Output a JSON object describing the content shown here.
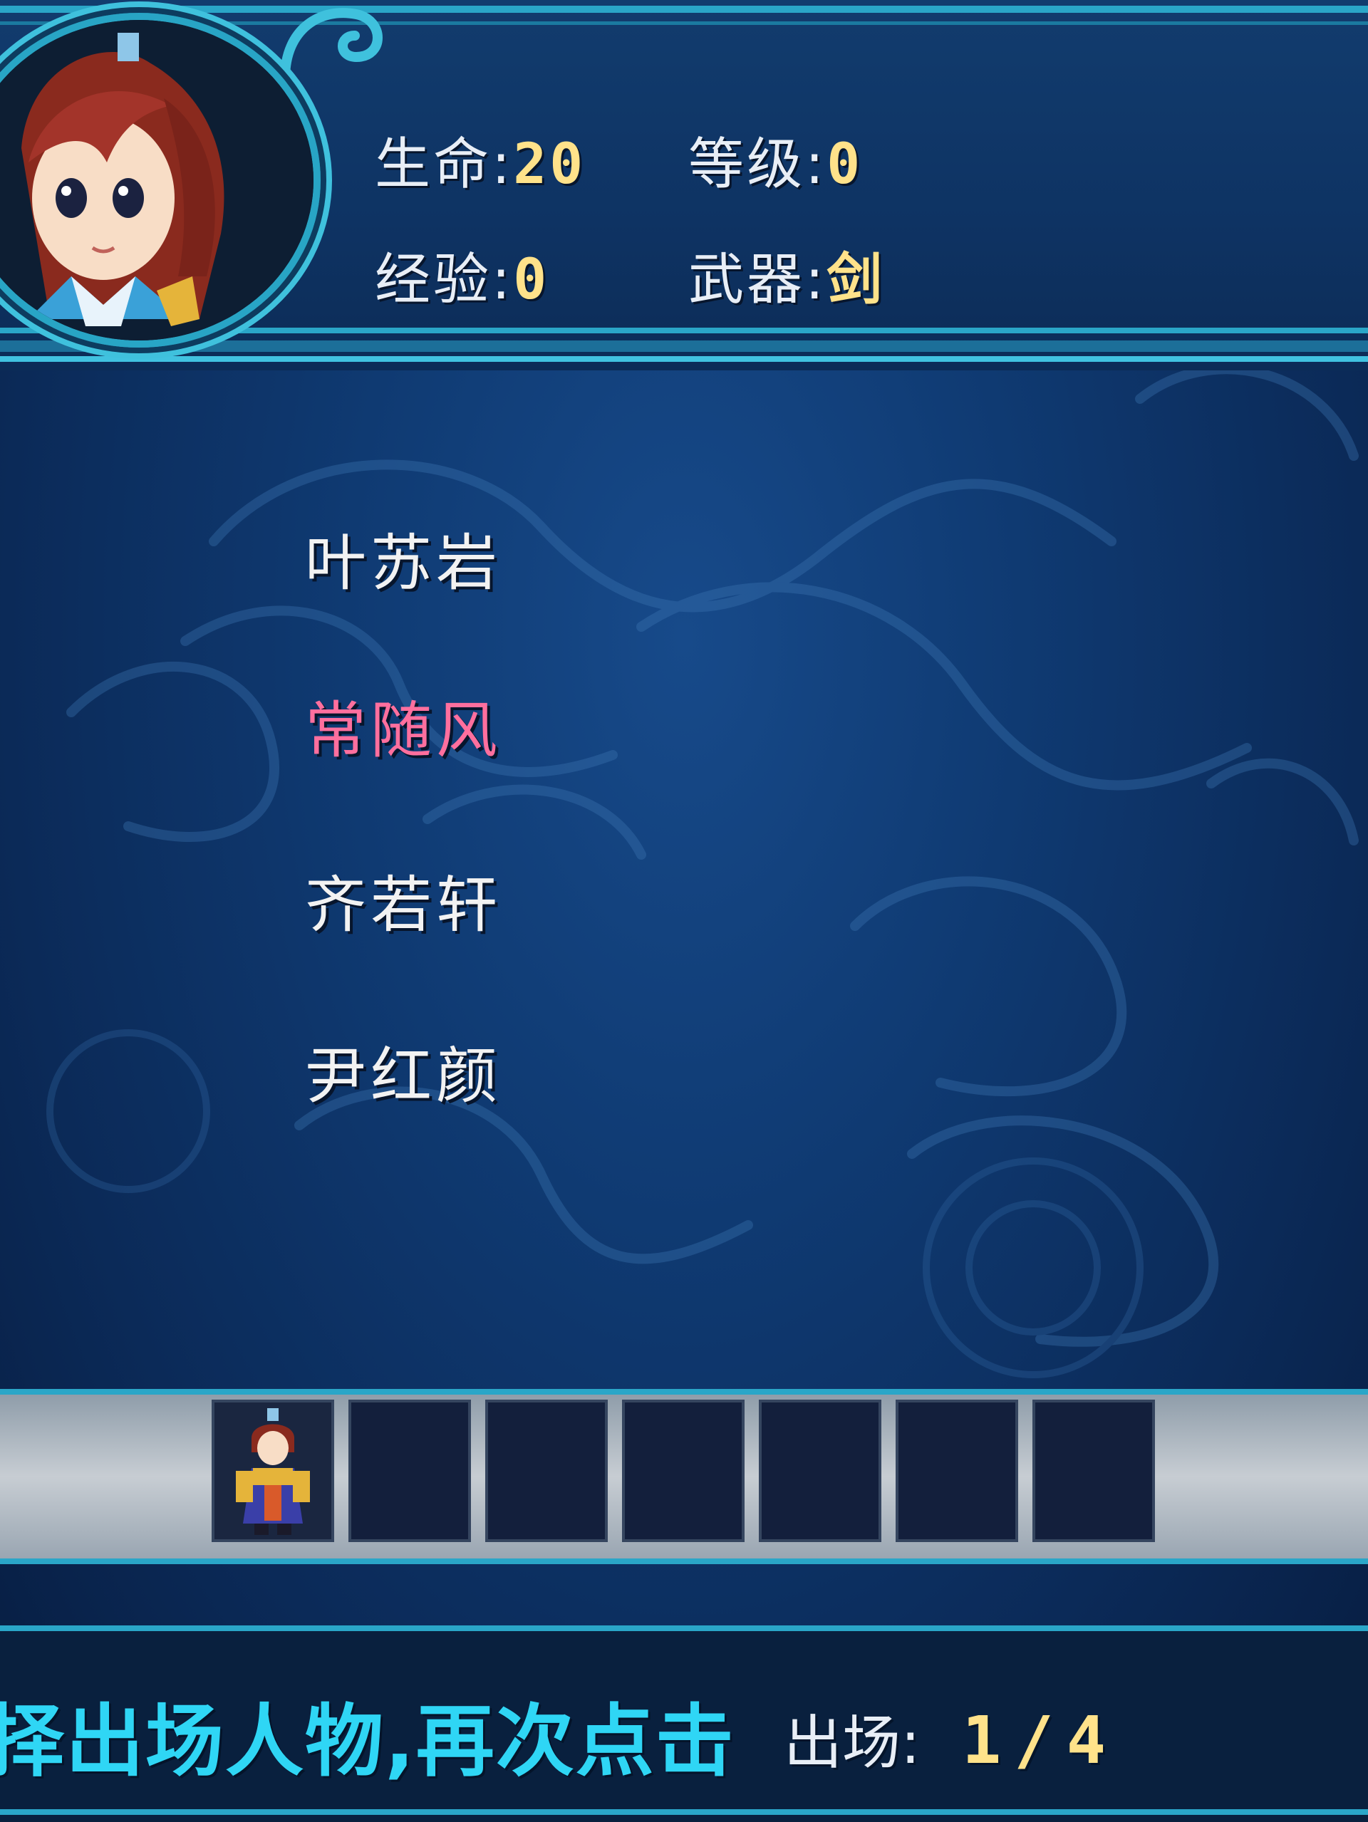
{
  "stats": {
    "hp_label": "生命:",
    "hp_value": "20",
    "level_label": "等级:",
    "level_value": "0",
    "exp_label": "经验:",
    "exp_value": "0",
    "weapon_label": "武器:",
    "weapon_value": "剑"
  },
  "characters": [
    {
      "name": "叶苏岩",
      "selected": false
    },
    {
      "name": "常随风",
      "selected": true
    },
    {
      "name": "齐若轩",
      "selected": false
    },
    {
      "name": "尹红颜",
      "selected": false
    }
  ],
  "party_slots": {
    "total": 7,
    "filled": 1
  },
  "footer": {
    "hint": "择出场人物,再次点击",
    "deploy_label": "出场:",
    "deploy_count": "1/4"
  },
  "colors": {
    "selected_name": "#ff6f9e",
    "value_yellow": "#ffe28a",
    "hint_cyan": "#2fd6f5",
    "frame_cyan": "#2aa6c8"
  }
}
